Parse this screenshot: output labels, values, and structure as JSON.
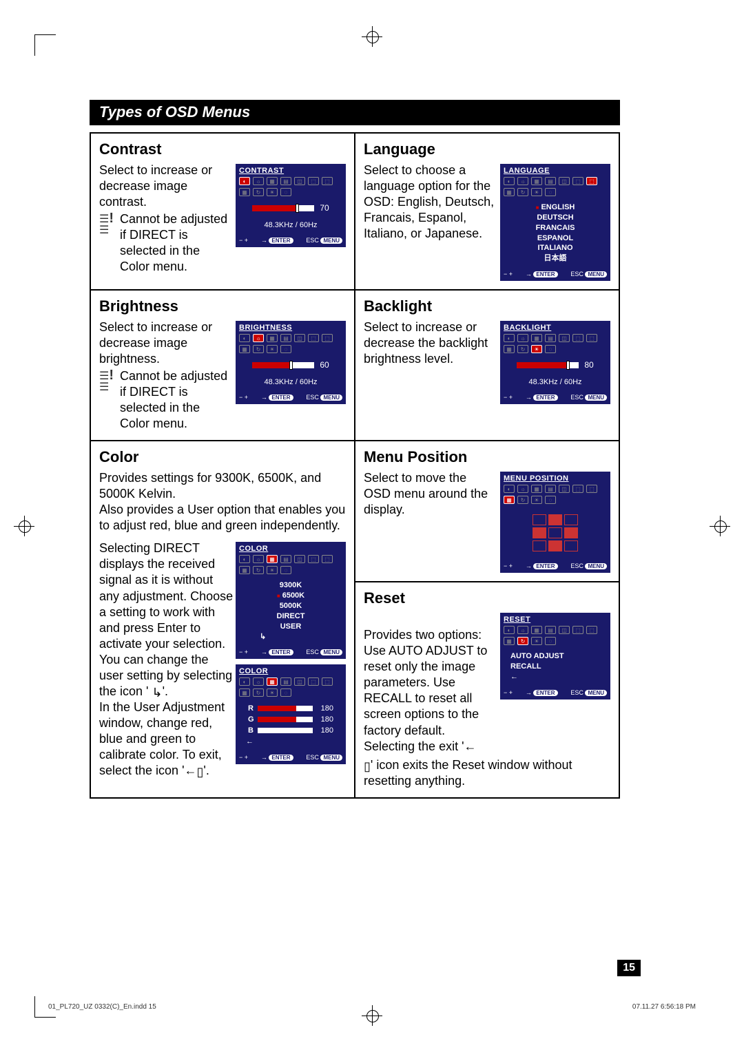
{
  "section_title": "Types of OSD Menus",
  "page_number": "15",
  "footer_left": "01_PL720_UZ 0332(C)_En.indd   15",
  "footer_right": "07.11.27   6:56:18 PM",
  "contrast": {
    "title": "Contrast",
    "body": "Select to increase or decrease image contrast.",
    "note": "Cannot be adjusted if DIRECT is selected in the Color menu.",
    "osd": {
      "title": "CONTRAST",
      "value": "70",
      "status": "48.3KHz  /    60Hz"
    }
  },
  "brightness": {
    "title": "Brightness",
    "body": "Select to increase or decrease image brightness.",
    "note": "Cannot be adjusted if DIRECT is selected in the Color menu.",
    "osd": {
      "title": "BRIGHTNESS",
      "value": "60",
      "status": "48.3KHz  /    60Hz"
    }
  },
  "language": {
    "title": "Language",
    "body": "Select to choose a language option for the OSD: English, Deutsch, Francais, Espanol, Italiano, or Japanese.",
    "osd": {
      "title": "LANGUAGE",
      "items": [
        "ENGLISH",
        "DEUTSCH",
        "FRANCAIS",
        "ESPANOL",
        "ITALIANO",
        "日本語"
      ],
      "selected": 0
    }
  },
  "backlight": {
    "title": "Backlight",
    "body": "Select to increase or decrease the backlight brightness level.",
    "osd": {
      "title": "BACKLIGHT",
      "value": "80",
      "status": "48.3KHz  /    60Hz"
    }
  },
  "color": {
    "title": "Color",
    "intro": "Provides settings for 9300K, 6500K, and 5000K Kelvin.\nAlso provides a User option that enables you to adjust red, blue and green independently.",
    "body1_a": "Selecting DIRECT displays the received signal as it is without any adjustment. Choose a setting to work with and press Enter to activate your selection.",
    "body1_b": "You can change the user setting by selecting the icon '",
    "body1_c": "↳",
    "body1_d": "'.",
    "body2_a": "In the User Adjustment window, change red, blue and green to calibrate color. To exit, select the icon '←",
    "body2_b": "'.",
    "osd1": {
      "title": "COLOR",
      "items": [
        "9300K",
        "6500K",
        "5000K",
        "DIRECT",
        "USER",
        "↳"
      ],
      "selected": 1
    },
    "osd2": {
      "title": "COLOR",
      "R": "180",
      "G": "180",
      "B": "180",
      "back": "←"
    }
  },
  "menupos": {
    "title": "Menu Position",
    "body": "Select to move the OSD menu around the display.",
    "osd": {
      "title": "MENU POSITION"
    }
  },
  "reset": {
    "title": "Reset",
    "body_a": "Provides two options:\nUse AUTO ADJUST to reset only the image parameters. Use RECALL to reset all screen options to the factory default. Selecting the exit '←",
    "body_b": "' icon exits the Reset window without resetting anything.",
    "osd": {
      "title": "RESET",
      "items": [
        "AUTO ADJUST",
        "RECALL",
        "←"
      ]
    }
  },
  "osd_footer": {
    "plusminus": "− +",
    "enter_arrow": "→",
    "enter_label": "ENTER",
    "esc": "ESC",
    "menu": "MENU"
  }
}
